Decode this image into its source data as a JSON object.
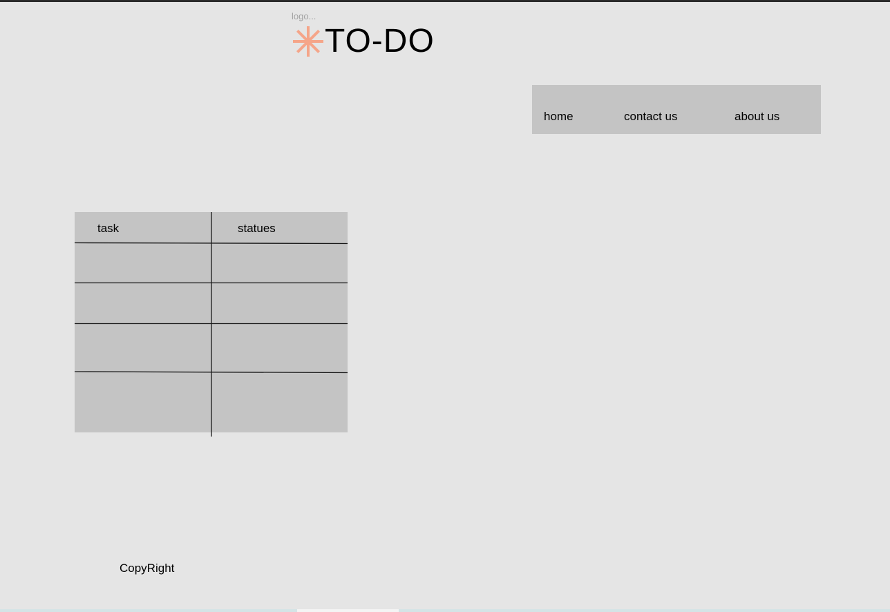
{
  "header": {
    "logo_caption": "logo...",
    "logo_icon": "asterisk-icon",
    "logo_text": "TO-DO",
    "accent_color": "#f5a589"
  },
  "nav": {
    "items": [
      {
        "label": "home"
      },
      {
        "label": "contact us"
      },
      {
        "label": "about us"
      }
    ]
  },
  "table": {
    "headers": [
      "task",
      "statues"
    ],
    "rows": [
      [
        "",
        ""
      ],
      [
        "",
        ""
      ],
      [
        "",
        ""
      ],
      [
        "",
        ""
      ]
    ]
  },
  "footer": {
    "copyright": "CopyRight"
  }
}
